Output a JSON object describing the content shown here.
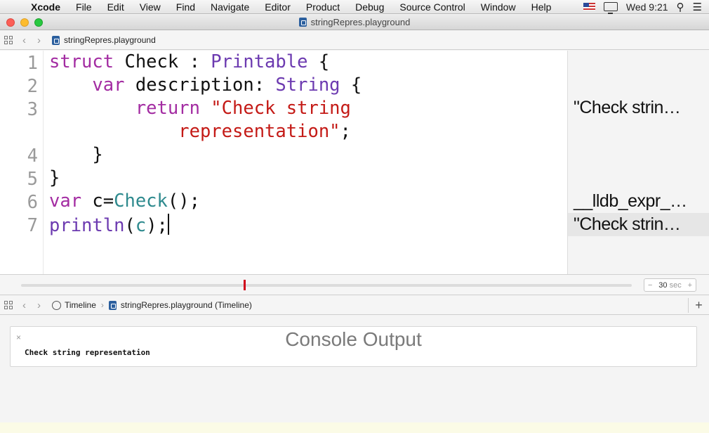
{
  "menubar": {
    "app_name": "Xcode",
    "items": [
      "File",
      "Edit",
      "View",
      "Find",
      "Navigate",
      "Editor",
      "Product",
      "Debug",
      "Source Control",
      "Window",
      "Help"
    ],
    "clock": "Wed 9:21"
  },
  "window": {
    "title": "stringRepres.playground"
  },
  "editor_jumpbar": {
    "file": "stringRepres.playground"
  },
  "editor": {
    "line_numbers": [
      "1",
      "2",
      "3",
      "4",
      "5",
      "6",
      "7"
    ],
    "lines": {
      "l1": {
        "kw": "struct",
        "name": " Check : ",
        "ty": "Printable",
        "rest": " {"
      },
      "l2": {
        "indent": "    ",
        "kw": "var",
        "name": " description: ",
        "ty": "String",
        "rest": " {"
      },
      "l3": {
        "indent": "        ",
        "kw": "return",
        "str": " \"Check string"
      },
      "l3b": {
        "indent": "            ",
        "str": "representation\"",
        "rest": ";"
      },
      "l4": {
        "text": "    }"
      },
      "l5": {
        "text": "}"
      },
      "l6": {
        "kw": "var",
        "pre": " c=",
        "fn": "Check",
        "rest": "();"
      },
      "l7": {
        "fn1": "println",
        "pre": "(",
        "fn": "c",
        "rest": ");"
      }
    }
  },
  "results": [
    "\"Check strin…",
    "__lldb_expr_…",
    "\"Check strin…"
  ],
  "timeline": {
    "stepper_value": "30",
    "stepper_unit": "sec",
    "minus": "−",
    "plus": "+",
    "position": 0.365
  },
  "timeline_jumpbar": {
    "timeline_label": "Timeline",
    "file": "stringRepres.playground (Timeline)"
  },
  "console": {
    "title": "Console Output",
    "close": "×",
    "output": "Check string representation"
  },
  "colors": {
    "keyword": "#a32ca2",
    "type": "#6c3ab0",
    "string": "#c41a16",
    "function": "#2e8a8e",
    "marker": "#d0021b"
  }
}
